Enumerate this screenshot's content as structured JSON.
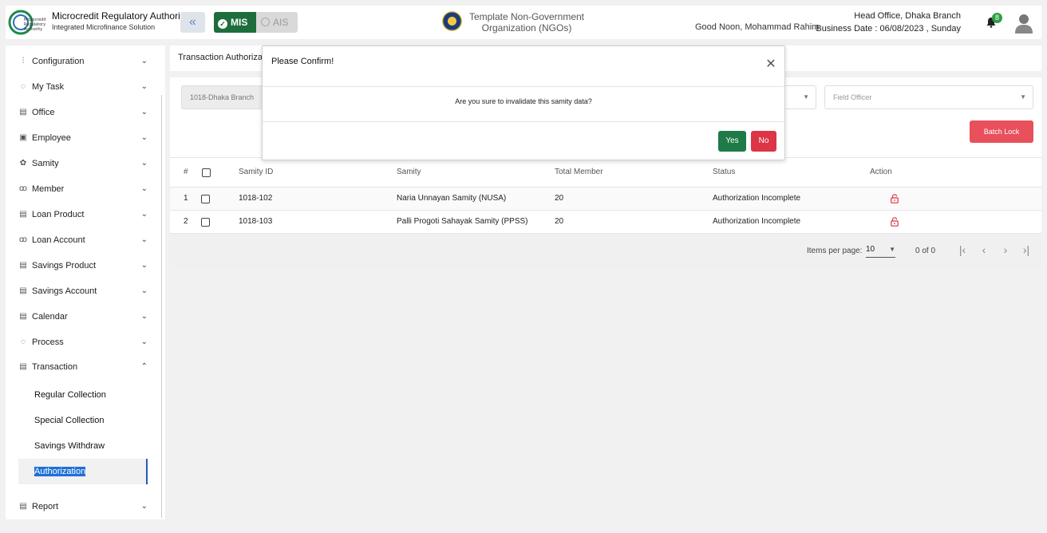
{
  "header": {
    "org_title": "Microcredit Regulatory Authority",
    "org_subtitle": "Integrated Microfinance Solution",
    "mis_label": "MIS",
    "ais_label": "AIS",
    "ngo_name": "Template Non-Government Organization (NGOs)",
    "greeting": "Good Noon, Mohammad Rahim",
    "office": "Head Office, Dhaka Branch",
    "business_date": "Business Date : 06/08/2023 , Sunday",
    "notification_count": "8"
  },
  "sidebar": {
    "items": [
      {
        "label": "Configuration",
        "icon": "sliders-icon"
      },
      {
        "label": "My Task",
        "icon": "loader-icon"
      },
      {
        "label": "Office",
        "icon": "doc-icon"
      },
      {
        "label": "Employee",
        "icon": "id-card-icon"
      },
      {
        "label": "Samity",
        "icon": "group-icon"
      },
      {
        "label": "Member",
        "icon": "users-icon"
      },
      {
        "label": "Loan Product",
        "icon": "doc-icon"
      },
      {
        "label": "Loan Account",
        "icon": "users-icon"
      },
      {
        "label": "Savings Product",
        "icon": "doc-icon"
      },
      {
        "label": "Savings Account",
        "icon": "doc-icon"
      },
      {
        "label": "Calendar",
        "icon": "doc-icon"
      },
      {
        "label": "Process",
        "icon": "loader-icon"
      },
      {
        "label": "Transaction",
        "icon": "doc-icon"
      }
    ],
    "transaction_sub": [
      {
        "label": "Regular Collection"
      },
      {
        "label": "Special Collection"
      },
      {
        "label": "Savings Withdraw"
      },
      {
        "label": "Authorization"
      }
    ],
    "report_label": "Report"
  },
  "breadcrumb": "Transaction Authorization",
  "filters": {
    "branch": "1018-Dhaka Branch",
    "field_officer_placeholder": "Field Officer"
  },
  "batch_lock_label": "Batch Lock",
  "table": {
    "headers": [
      "#",
      "Samity ID",
      "Samity",
      "Total Member",
      "Status",
      "Action"
    ],
    "rows": [
      {
        "no": "1",
        "samity_id": "1018-102",
        "samity": "Naria Unnayan Samity (NUSA)",
        "total_member": "20",
        "status": "Authorization Incomplete"
      },
      {
        "no": "2",
        "samity_id": "1018-103",
        "samity": "Palli Progoti Sahayak Samity (PPSS)",
        "total_member": "20",
        "status": "Authorization Incomplete"
      }
    ]
  },
  "paginator": {
    "items_per_page_label": "Items per page:",
    "page_size": "10",
    "range": "0 of 0"
  },
  "modal": {
    "title": "Please Confirm!",
    "message": "Are you sure to invalidate this samity data?",
    "yes_label": "Yes",
    "no_label": "No"
  },
  "colors": {
    "mis_green": "#1e6d3c",
    "danger_red": "#dc3545",
    "batch_lock_red": "#e8505b",
    "active_blue": "#1f6fd6"
  }
}
